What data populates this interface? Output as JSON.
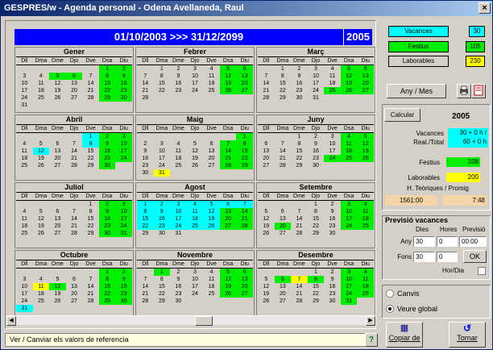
{
  "title": "GESPRES/w - Agenda personal - Odena Avellaneda, Raul",
  "close": "×",
  "range": "01/10/2003 >>> 31/12/2099",
  "year": "2005",
  "dow": [
    "Dll",
    "Dma",
    "Dme",
    "Djo",
    "Dve",
    "Dsa",
    "Diu"
  ],
  "months": [
    {
      "name": "Gener",
      "rows": [
        [
          "",
          "",
          "",
          "",
          "",
          "1",
          "2"
        ],
        [
          "3",
          "4",
          "5",
          "6",
          "7",
          "8",
          "9"
        ],
        [
          "10",
          "11",
          "12",
          "13",
          "14",
          "15",
          "16"
        ],
        [
          "17",
          "18",
          "19",
          "20",
          "21",
          "22",
          "23"
        ],
        [
          "24",
          "25",
          "26",
          "27",
          "28",
          "29",
          "30"
        ],
        [
          "31",
          "",
          "",
          "",
          "",
          "",
          ""
        ]
      ],
      "special": {
        "5": "w",
        "6": "w",
        "29": "w",
        "30": "w",
        "1": "w",
        "2": "w",
        "8": "w",
        "9": "w",
        "15": "w",
        "16": "w",
        "22": "w",
        "23": "w"
      }
    },
    {
      "name": "Febrer",
      "rows": [
        [
          "",
          "1",
          "2",
          "3",
          "4",
          "5",
          "6"
        ],
        [
          "7",
          "8",
          "9",
          "10",
          "11",
          "12",
          "13"
        ],
        [
          "14",
          "15",
          "16",
          "17",
          "18",
          "19",
          "20"
        ],
        [
          "21",
          "22",
          "23",
          "24",
          "25",
          "26",
          "27"
        ],
        [
          "28",
          "",
          "",
          "",
          "",
          "",
          ""
        ]
      ],
      "special": {
        "5": "w",
        "6": "w",
        "12": "w",
        "13": "w",
        "19": "w",
        "20": "w",
        "26": "w",
        "27": "w"
      }
    },
    {
      "name": "Març",
      "rows": [
        [
          "",
          "1",
          "2",
          "3",
          "4",
          "5",
          "6"
        ],
        [
          "7",
          "8",
          "9",
          "10",
          "11",
          "12",
          "13"
        ],
        [
          "14",
          "15",
          "16",
          "17",
          "18",
          "19",
          "20"
        ],
        [
          "21",
          "22",
          "23",
          "24",
          "25",
          "26",
          "27"
        ],
        [
          "28",
          "29",
          "30",
          "31",
          "",
          "",
          ""
        ]
      ],
      "special": {
        "5": "w",
        "6": "w",
        "12": "w",
        "13": "w",
        "19": "w",
        "20": "w",
        "25": "w",
        "26": "w",
        "27": "w"
      }
    },
    {
      "name": "Abril",
      "rows": [
        [
          "",
          "",
          "",
          "",
          "1",
          "2",
          "3"
        ],
        [
          "4",
          "5",
          "6",
          "7",
          "8",
          "9",
          "10"
        ],
        [
          "11",
          "12",
          "13",
          "14",
          "15",
          "16",
          "17"
        ],
        [
          "18",
          "19",
          "20",
          "21",
          "22",
          "23",
          "24"
        ],
        [
          "25",
          "26",
          "27",
          "28",
          "29",
          "30",
          ""
        ]
      ],
      "special": {
        "1": "v",
        "2": "w",
        "3": "w",
        "8": "v",
        "9": "w",
        "10": "w",
        "12": "v",
        "16": "w",
        "17": "w",
        "23": "w",
        "24": "w",
        "30": "w"
      }
    },
    {
      "name": "Maig",
      "rows": [
        [
          "",
          "",
          "",
          "",
          "",
          "",
          "1"
        ],
        [
          "2",
          "3",
          "4",
          "5",
          "6",
          "7",
          "8"
        ],
        [
          "9",
          "10",
          "11",
          "12",
          "13",
          "14",
          "15"
        ],
        [
          "16",
          "17",
          "18",
          "19",
          "20",
          "21",
          "22"
        ],
        [
          "23",
          "24",
          "25",
          "26",
          "27",
          "28",
          "29"
        ],
        [
          "30",
          "31",
          "",
          "",
          "",
          "",
          ""
        ]
      ],
      "special": {
        "1": "w",
        "7": "w",
        "8": "w",
        "14": "w",
        "15": "w",
        "21": "w",
        "22": "w",
        "28": "w",
        "29": "w",
        "31": "y"
      }
    },
    {
      "name": "Juny",
      "rows": [
        [
          "",
          "",
          "1",
          "2",
          "3",
          "4",
          "5"
        ],
        [
          "6",
          "7",
          "8",
          "9",
          "10",
          "11",
          "12"
        ],
        [
          "13",
          "14",
          "15",
          "16",
          "17",
          "18",
          "19"
        ],
        [
          "20",
          "21",
          "22",
          "23",
          "24",
          "25",
          "26"
        ],
        [
          "27",
          "28",
          "29",
          "30",
          "",
          "",
          ""
        ]
      ],
      "special": {
        "4": "w",
        "5": "w",
        "11": "w",
        "12": "w",
        "18": "w",
        "19": "w",
        "24": "w",
        "25": "w",
        "26": "w"
      }
    },
    {
      "name": "Juliol",
      "rows": [
        [
          "",
          "",
          "",
          "",
          "1",
          "2",
          "3"
        ],
        [
          "4",
          "5",
          "6",
          "7",
          "8",
          "9",
          "10"
        ],
        [
          "11",
          "12",
          "13",
          "14",
          "15",
          "16",
          "17"
        ],
        [
          "18",
          "19",
          "20",
          "21",
          "22",
          "23",
          "24"
        ],
        [
          "25",
          "26",
          "27",
          "28",
          "29",
          "30",
          "31"
        ]
      ],
      "special": {
        "2": "w",
        "3": "w",
        "9": "w",
        "10": "w",
        "16": "w",
        "17": "w",
        "23": "w",
        "24": "w",
        "30": "w",
        "31": "w"
      }
    },
    {
      "name": "Agost",
      "rows": [
        [
          "1",
          "2",
          "3",
          "4",
          "5",
          "6",
          "7"
        ],
        [
          "8",
          "9",
          "10",
          "11",
          "12",
          "13",
          "14"
        ],
        [
          "15",
          "16",
          "17",
          "18",
          "19",
          "20",
          "21"
        ],
        [
          "22",
          "23",
          "24",
          "25",
          "26",
          "27",
          "28"
        ],
        [
          "29",
          "30",
          "31",
          "",
          "",
          "",
          ""
        ]
      ],
      "special": {
        "1": "v",
        "2": "v",
        "3": "v",
        "4": "v",
        "5": "v",
        "6": "v",
        "7": "v",
        "8": "v",
        "9": "v",
        "10": "v",
        "11": "v",
        "12": "v",
        "13": "w",
        "14": "w",
        "15": "v",
        "16": "v",
        "17": "v",
        "18": "v",
        "19": "v",
        "20": "w",
        "21": "w",
        "22": "v",
        "23": "v",
        "24": "v",
        "25": "v",
        "26": "v",
        "27": "w",
        "28": "w"
      }
    },
    {
      "name": "Setembre",
      "rows": [
        [
          "",
          "",
          "",
          "1",
          "2",
          "3",
          "4"
        ],
        [
          "5",
          "6",
          "7",
          "8",
          "9",
          "10",
          "11"
        ],
        [
          "12",
          "13",
          "14",
          "15",
          "16",
          "17",
          "18"
        ],
        [
          "19",
          "20",
          "21",
          "22",
          "23",
          "24",
          "25"
        ],
        [
          "26",
          "27",
          "28",
          "29",
          "30",
          "",
          ""
        ]
      ],
      "special": {
        "3": "w",
        "4": "w",
        "10": "w",
        "11": "w",
        "17": "w",
        "18": "w",
        "20": "w",
        "24": "w",
        "25": "w"
      }
    },
    {
      "name": "Octubre",
      "rows": [
        [
          "",
          "",
          "",
          "",
          "",
          "1",
          "2"
        ],
        [
          "3",
          "4",
          "5",
          "6",
          "7",
          "8",
          "9"
        ],
        [
          "10",
          "11",
          "12",
          "13",
          "14",
          "15",
          "16"
        ],
        [
          "17",
          "18",
          "19",
          "20",
          "21",
          "22",
          "23"
        ],
        [
          "24",
          "25",
          "26",
          "27",
          "28",
          "29",
          "30"
        ],
        [
          "31",
          "",
          "",
          "",
          "",
          "",
          ""
        ]
      ],
      "special": {
        "1": "w",
        "2": "w",
        "8": "w",
        "9": "w",
        "11": "y",
        "12": "w",
        "15": "w",
        "16": "w",
        "22": "w",
        "23": "w",
        "29": "w",
        "30": "w",
        "31": "v"
      }
    },
    {
      "name": "Novembre",
      "rows": [
        [
          "",
          "1",
          "2",
          "3",
          "4",
          "5",
          "6"
        ],
        [
          "7",
          "8",
          "9",
          "10",
          "11",
          "12",
          "13"
        ],
        [
          "14",
          "15",
          "16",
          "17",
          "18",
          "19",
          "20"
        ],
        [
          "21",
          "22",
          "23",
          "24",
          "25",
          "26",
          "27"
        ],
        [
          "28",
          "29",
          "30",
          "",
          "",
          "",
          ""
        ]
      ],
      "special": {
        "1": "w",
        "5": "w",
        "6": "w",
        "12": "w",
        "13": "w",
        "19": "w",
        "20": "w",
        "26": "w",
        "27": "w"
      }
    },
    {
      "name": "Desembre",
      "rows": [
        [
          "",
          "",
          "",
          "1",
          "2",
          "3",
          "4"
        ],
        [
          "5",
          "6",
          "7",
          "8",
          "9",
          "10",
          "11"
        ],
        [
          "12",
          "13",
          "14",
          "15",
          "16",
          "17",
          "18"
        ],
        [
          "19",
          "20",
          "21",
          "22",
          "23",
          "24",
          "25"
        ],
        [
          "26",
          "27",
          "28",
          "29",
          "30",
          "31",
          ""
        ]
      ],
      "special": {
        "3": "w",
        "4": "w",
        "6": "w",
        "7": "y",
        "8": "w",
        "10": "w",
        "11": "w",
        "17": "w",
        "18": "w",
        "24": "w",
        "25": "w",
        "31": "w"
      }
    }
  ],
  "status": "Ver / Canviar els valors de referencia",
  "help": "?",
  "legend": {
    "vacances": "Vacances",
    "vacances_count": "30",
    "festius": "Festius",
    "festius_count": "105",
    "laborables": "Laborables",
    "laborables_count": "230"
  },
  "anymes": "Any / Mes",
  "calcular": "Calcular",
  "stat_year": "2005",
  "vacances_label": "Vacances",
  "realtotal_label": "Real./Total",
  "vacances_val1": "30 + 0 h /",
  "vacances_val2": "60 + 0 h",
  "festius_label": "Festius",
  "festius_val": "108",
  "laborables_label": "Laborables",
  "laborables_val": "200",
  "hteoriques_label": "H. Teòriques / Promig",
  "hteoriques_val": "1561:00",
  "promig_val": "7:48",
  "previsio_title": "Previsió vacances",
  "col_dies": "Dies",
  "col_hores": "Hores",
  "col_previsio": "Previsió",
  "any_label": "Any",
  "any_dies": "30",
  "any_hores": "0",
  "any_previsio": "00:00",
  "fons_label": "Fons",
  "fons_dies": "30",
  "fons_hores": "0",
  "ok": "OK",
  "hordia": "Hor/Dia",
  "canvis": "Canvis",
  "veure": "Veure global",
  "copiar": "Copiar de",
  "tornar": "Tornar",
  "colors": {
    "weekend": "#00ee00",
    "vacation": "#00ffff",
    "yellow": "#ffff00",
    "banner": "#0000ff"
  }
}
